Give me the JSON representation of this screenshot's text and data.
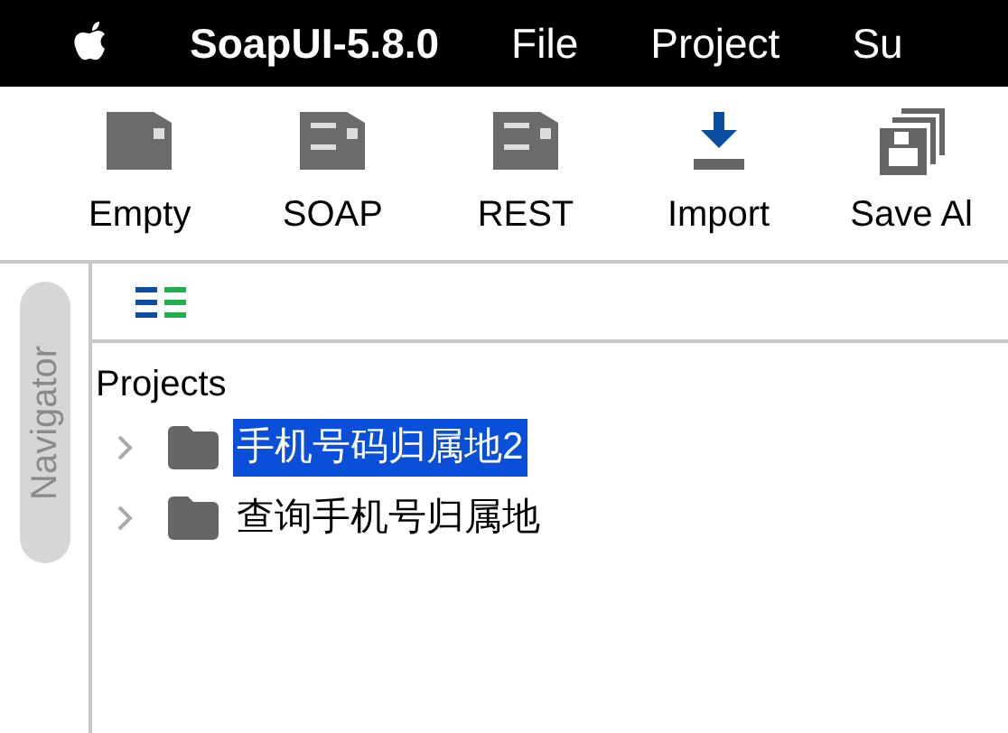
{
  "menu_bar": {
    "app_name": "SoapUI-5.8.0",
    "items": [
      "File",
      "Project",
      "Su"
    ]
  },
  "toolbar": {
    "buttons": [
      {
        "kind": "empty",
        "label": "Empty"
      },
      {
        "kind": "soap",
        "label": "SOAP"
      },
      {
        "kind": "rest",
        "label": "REST"
      },
      {
        "kind": "import",
        "label": "Import"
      },
      {
        "kind": "save_all",
        "label": "Save Al"
      }
    ]
  },
  "side_tab": {
    "label": "Navigator"
  },
  "navigator": {
    "root": "Projects",
    "items": [
      {
        "label": "手机号码归属地2",
        "selected": true,
        "expanded": false
      },
      {
        "label": "查询手机号归属地",
        "selected": false,
        "expanded": false
      }
    ]
  }
}
